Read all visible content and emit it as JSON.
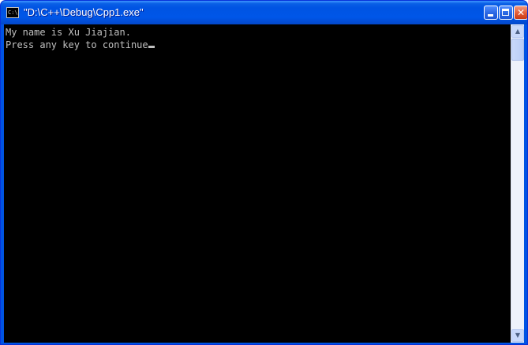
{
  "window": {
    "title": "\"D:\\C++\\Debug\\Cpp1.exe\"",
    "icon_label": "C:\\",
    "controls": {
      "minimize": "minimize-icon",
      "maximize": "maximize-icon",
      "close": "✕"
    }
  },
  "console": {
    "lines": [
      "My name is Xu Jiajian.",
      "Press any key to continue"
    ]
  },
  "scrollbar": {
    "up_arrow": "▲",
    "down_arrow": "▼"
  },
  "colors": {
    "titlebar": "#0054e3",
    "console_bg": "#000000",
    "console_text": "#c0c0c0",
    "close_button": "#e45b35"
  }
}
